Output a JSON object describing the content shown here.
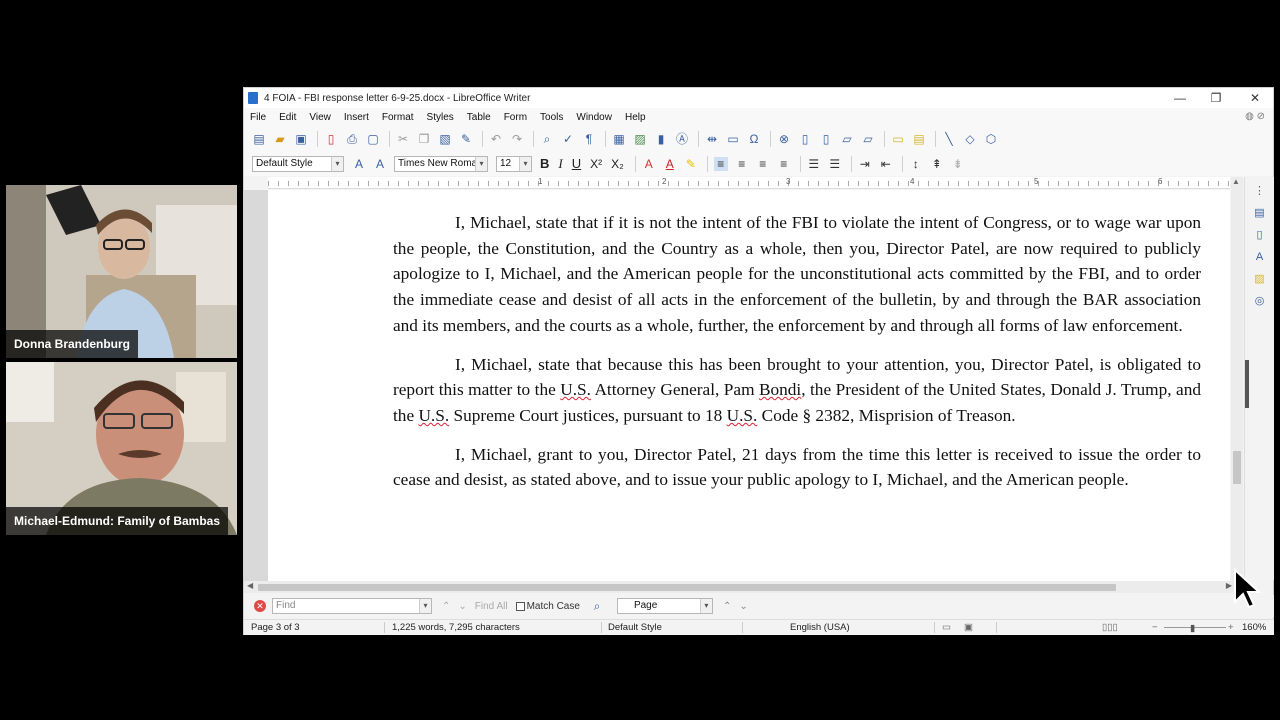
{
  "participants": [
    {
      "name": "Donna Brandenburg"
    },
    {
      "name": "Michael-Edmund: Family of Bambas"
    }
  ],
  "window": {
    "title": "4 FOIA - FBI response letter 6-9-25.docx - LibreOffice Writer",
    "controls": {
      "minimize": "—",
      "restore": "❐",
      "close": "✕"
    }
  },
  "menu": [
    "File",
    "Edit",
    "View",
    "Insert",
    "Format",
    "Styles",
    "Table",
    "Form",
    "Tools",
    "Window",
    "Help"
  ],
  "formatting": {
    "paragraph_style": "Default Style",
    "font_name": "Times New Roman",
    "font_size": "12",
    "bold": "B",
    "italic": "I",
    "underline": "U",
    "superscript": "X²",
    "subscript": "X₂"
  },
  "ruler": {
    "numbers": [
      "1",
      "2",
      "3",
      "4",
      "5",
      "6"
    ]
  },
  "document": {
    "paragraph1": {
      "a": "I, Michael, state that if it is not the intent of the FBI to violate the intent of Congress, or to wage war upon the people, the Constitution, and the Country as a whole, then you, Director Patel, are now required to publicly apologize to I, Michael, and the American people for the unconstitutional acts committed by the FBI, and to order the immediate cease and desist of all acts in the enforcement of the bulletin, by and through the BAR association and its members, and the courts as a whole, further, the enforcement by and through all forms of law enforcement."
    },
    "paragraph2": {
      "a": "I, Michael, state that because this has been brought to your attention, you, Director Patel, is obligated to report this matter to the ",
      "us1": "U.S.",
      "b": " Attorney General, Pam ",
      "bondi": "Bondi",
      "c": ", the President of the United States, Donald J. Trump, and the ",
      "us2": "U.S.",
      "d": " Supreme Court justices, pursuant to 18 ",
      "us3": "U.S.",
      "e": " Code § 2382, Misprision of Treason."
    },
    "paragraph3": {
      "a": "I, Michael, grant to you, Director Patel, 21 days from the time this letter is received to issue the order to cease and desist, as stated above, and to issue your public apology to I, Michael, and the American people."
    }
  },
  "findbar": {
    "placeholder": "Find",
    "find_all": "Find All",
    "match_case": "Match Case",
    "navigate_by": "Page"
  },
  "statusbar": {
    "page": "Page 3 of 3",
    "counts": "1,225 words, 7,295 characters",
    "page_style": "Default Style",
    "language": "English (USA)",
    "zoom": "160%"
  }
}
